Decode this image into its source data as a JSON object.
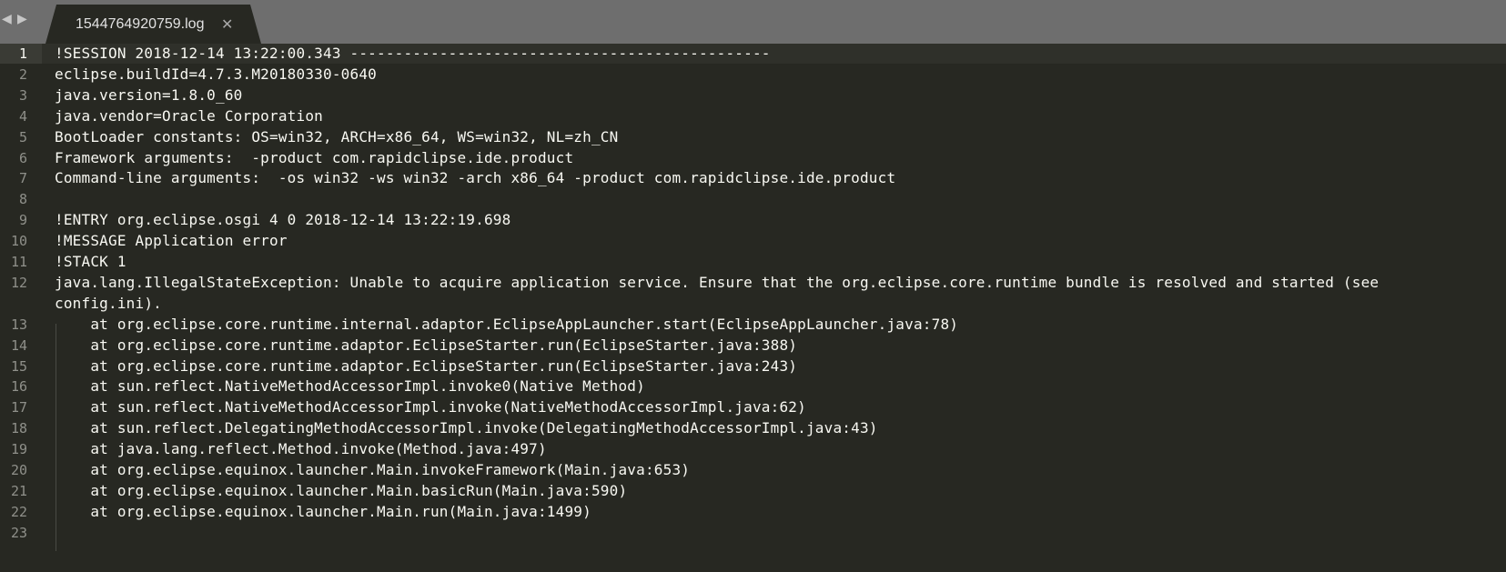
{
  "tabbar": {
    "back_arrow": "◀",
    "forward_arrow": "▶",
    "active_tab": {
      "title": "1544764920759.log",
      "close_glyph": "✕"
    }
  },
  "editor": {
    "line_numbers": [
      "1",
      "2",
      "3",
      "4",
      "5",
      "6",
      "7",
      "8",
      "9",
      "10",
      "11",
      "12",
      "13",
      "14",
      "15",
      "16",
      "17",
      "18",
      "19",
      "20",
      "21",
      "22",
      "23"
    ],
    "lines": [
      "!SESSION 2018-12-14 13:22:00.343 -----------------------------------------------",
      "eclipse.buildId=4.7.3.M20180330-0640",
      "java.version=1.8.0_60",
      "java.vendor=Oracle Corporation",
      "BootLoader constants: OS=win32, ARCH=x86_64, WS=win32, NL=zh_CN",
      "Framework arguments:  -product com.rapidclipse.ide.product",
      "Command-line arguments:  -os win32 -ws win32 -arch x86_64 -product com.rapidclipse.ide.product",
      "",
      "!ENTRY org.eclipse.osgi 4 0 2018-12-14 13:22:19.698",
      "!MESSAGE Application error",
      "!STACK 1",
      "java.lang.IllegalStateException: Unable to acquire application service. Ensure that the org.eclipse.core.runtime bundle is resolved and started (see",
      "config.ini).",
      "    at org.eclipse.core.runtime.internal.adaptor.EclipseAppLauncher.start(EclipseAppLauncher.java:78)",
      "    at org.eclipse.core.runtime.adaptor.EclipseStarter.run(EclipseStarter.java:388)",
      "    at org.eclipse.core.runtime.adaptor.EclipseStarter.run(EclipseStarter.java:243)",
      "    at sun.reflect.NativeMethodAccessorImpl.invoke0(Native Method)",
      "    at sun.reflect.NativeMethodAccessorImpl.invoke(NativeMethodAccessorImpl.java:62)",
      "    at sun.reflect.DelegatingMethodAccessorImpl.invoke(DelegatingMethodAccessorImpl.java:43)",
      "    at java.lang.reflect.Method.invoke(Method.java:497)",
      "    at org.eclipse.equinox.launcher.Main.invokeFramework(Main.java:653)",
      "    at org.eclipse.equinox.launcher.Main.basicRun(Main.java:590)",
      "    at org.eclipse.equinox.launcher.Main.run(Main.java:1499)",
      ""
    ]
  },
  "colors": {
    "background": "#272822",
    "tabbar": "#6e6e6e",
    "text": "#f8f8f2",
    "line_number": "#8f908a"
  }
}
